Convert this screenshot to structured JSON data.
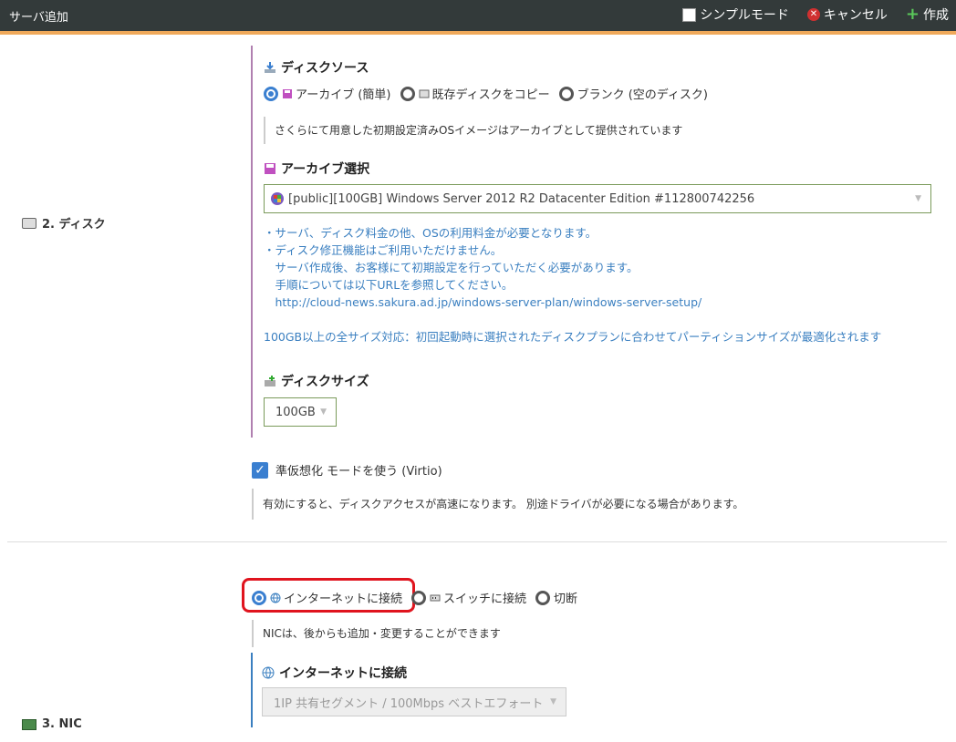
{
  "header": {
    "title": "サーバ追加",
    "simple_mode": "シンプルモード",
    "cancel": "キャンセル",
    "create": "作成"
  },
  "disk": {
    "section_label": "2. ディスク",
    "source_heading": "ディスクソース",
    "source_options": [
      "アーカイブ (簡単)",
      "既存ディスクをコピー",
      "ブランク (空のディスク)"
    ],
    "source_note": "さくらにて用意した初期設定済みOSイメージはアーカイブとして提供されています",
    "archive_heading": "アーカイブ選択",
    "archive_value": "[public][100GB] Windows Server 2012 R2 Datacenter Edition #112800742256",
    "info_lines": "・サーバ、ディスク料金の他、OSの利用料金が必要となります。\n・ディスク修正機能はご利用いただけません。\n　サーバ作成後、お客様にて初期設定を行っていただく必要があります。\n　手順については以下URLを参照してください。\n　http://cloud-news.sakura.ad.jp/windows-server-plan/windows-server-setup/",
    "partition_note": "100GB以上の全サイズ対応：初回起動時に選択されたディスクプランに合わせてパーティションサイズが最適化されます",
    "size_heading": "ディスクサイズ",
    "size_value": "100GB",
    "virtio_label": "準仮想化 モードを使う (Virtio)",
    "virtio_note": "有効にすると、ディスクアクセスが高速になります。 別途ドライバが必要になる場合があります。"
  },
  "nic": {
    "section_label": "3. NIC",
    "options": [
      "インターネットに接続",
      "スイッチに接続",
      "切断"
    ],
    "note": "NICは、後からも追加・変更することができます",
    "internet_heading": "インターネットに接続",
    "segment_value": "1IP 共有セグメント / 100Mbps ベストエフォート"
  }
}
